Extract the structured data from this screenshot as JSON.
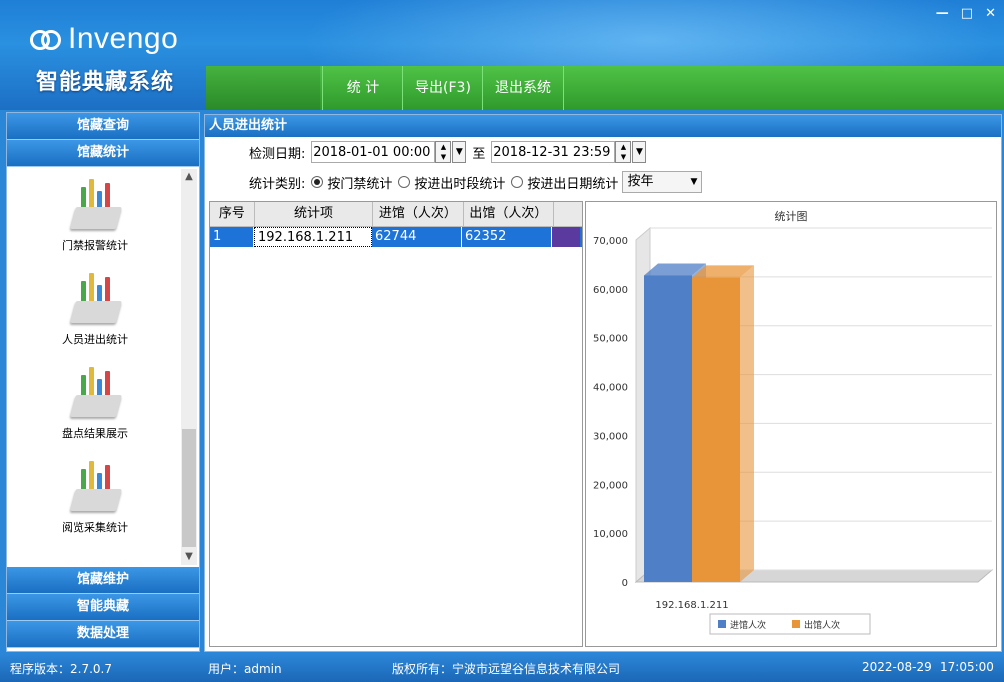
{
  "header": {
    "brand": "Invengo",
    "system_name": "智能典藏系统",
    "window_controls": [
      "minimize",
      "maximize",
      "close"
    ],
    "nav": [
      "统 计",
      "导出(F3)",
      "退出系统"
    ]
  },
  "sidebar": {
    "top_items": [
      "馆藏查询",
      "馆藏统计"
    ],
    "entries": [
      {
        "label": "门禁报警统计",
        "icon": "chart-icon"
      },
      {
        "label": "人员进出统计",
        "icon": "chart-icon"
      },
      {
        "label": "盘点结果展示",
        "icon": "chart-icon"
      },
      {
        "label": "阅览采集统计",
        "icon": "chart-icon"
      }
    ],
    "bottom_items": [
      "馆藏维护",
      "智能典藏",
      "数据处理"
    ]
  },
  "panel": {
    "title": "人员进出统计",
    "date_label": "检测日期:",
    "date_from": "2018-01-01 00:00",
    "date_to_sep": "至",
    "date_to": "2018-12-31 23:59",
    "type_label": "统计类别:",
    "radios": [
      {
        "label": "按门禁统计",
        "checked": true
      },
      {
        "label": "按进出时段统计",
        "checked": false
      },
      {
        "label": "按进出日期统计",
        "checked": false
      }
    ],
    "period_select": "按年"
  },
  "grid": {
    "columns": [
      "序号",
      "统计项",
      "进馆（人次）",
      "出馆（人次）"
    ],
    "rows": [
      [
        "1",
        "192.168.1.211",
        "62744",
        "62352"
      ]
    ]
  },
  "chart_data": {
    "type": "bar",
    "title": "统计图",
    "categories": [
      "192.168.1.211"
    ],
    "series": [
      {
        "name": "进馆人次",
        "values": [
          62744
        ],
        "color": "#4f7fc6"
      },
      {
        "name": "出馆人次",
        "values": [
          62352
        ],
        "color": "#e8953a"
      }
    ],
    "ylim": [
      0,
      70000
    ],
    "yticks": [
      "0",
      "10,000",
      "20,000",
      "30,000",
      "40,000",
      "50,000",
      "60,000",
      "70,000"
    ],
    "legend": "bottom",
    "grid": true
  },
  "status": {
    "version": "程序版本：2.7.0.7",
    "user": "用户：admin",
    "copyright": "版权所有：宁波市远望谷信息技术有限公司",
    "date": "2022-08-29",
    "time": "17:05:00"
  }
}
